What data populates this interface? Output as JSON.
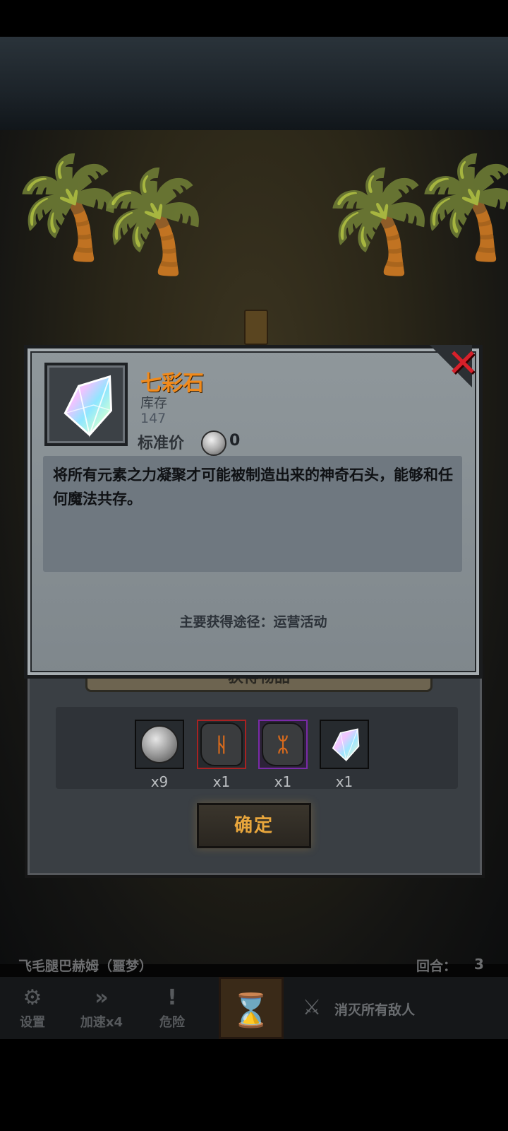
{
  "item": {
    "name": "七彩石",
    "stock_label": "库存",
    "stock_value": "147",
    "price_label": "标准价",
    "price_value": "0",
    "description": "将所有元素之力凝聚才可能被制造出来的神奇石头，能够和任何魔法共存。",
    "source": "主要获得途径：运营活动",
    "icon": "rainbow-crystal-icon"
  },
  "reward": {
    "banner": "获得物品",
    "items": [
      {
        "icon": "silver-coin-icon",
        "qty": "x9",
        "border": "#0c0c0c"
      },
      {
        "icon": "fire-rune-stone-icon",
        "qty": "x1",
        "border": "#a82222",
        "glyph": "ᚺ"
      },
      {
        "icon": "rune-stone-icon",
        "qty": "x1",
        "border": "#7a2aa8",
        "glyph": "ᛯ"
      },
      {
        "icon": "rainbow-crystal-icon",
        "qty": "x1",
        "border": "#0c0c0c"
      }
    ],
    "confirm_label": "确定"
  },
  "hud": {
    "boss_name": "飞毛腿巴赫姆（噩梦）",
    "round_label": "回合：",
    "round_value": "3",
    "buttons": [
      {
        "label": "设置",
        "icon": "gear-icon",
        "glyph": "⚙"
      },
      {
        "label": "加速x4",
        "icon": "fast-forward-icon",
        "glyph": "»"
      },
      {
        "label": "危险",
        "icon": "exclamation-icon",
        "glyph": "!"
      }
    ],
    "objective": "消灭所有敌人"
  },
  "colors": {
    "item_name": "#f08a1c",
    "close": "#d6202a",
    "confirm_text": "#e8a63c"
  }
}
